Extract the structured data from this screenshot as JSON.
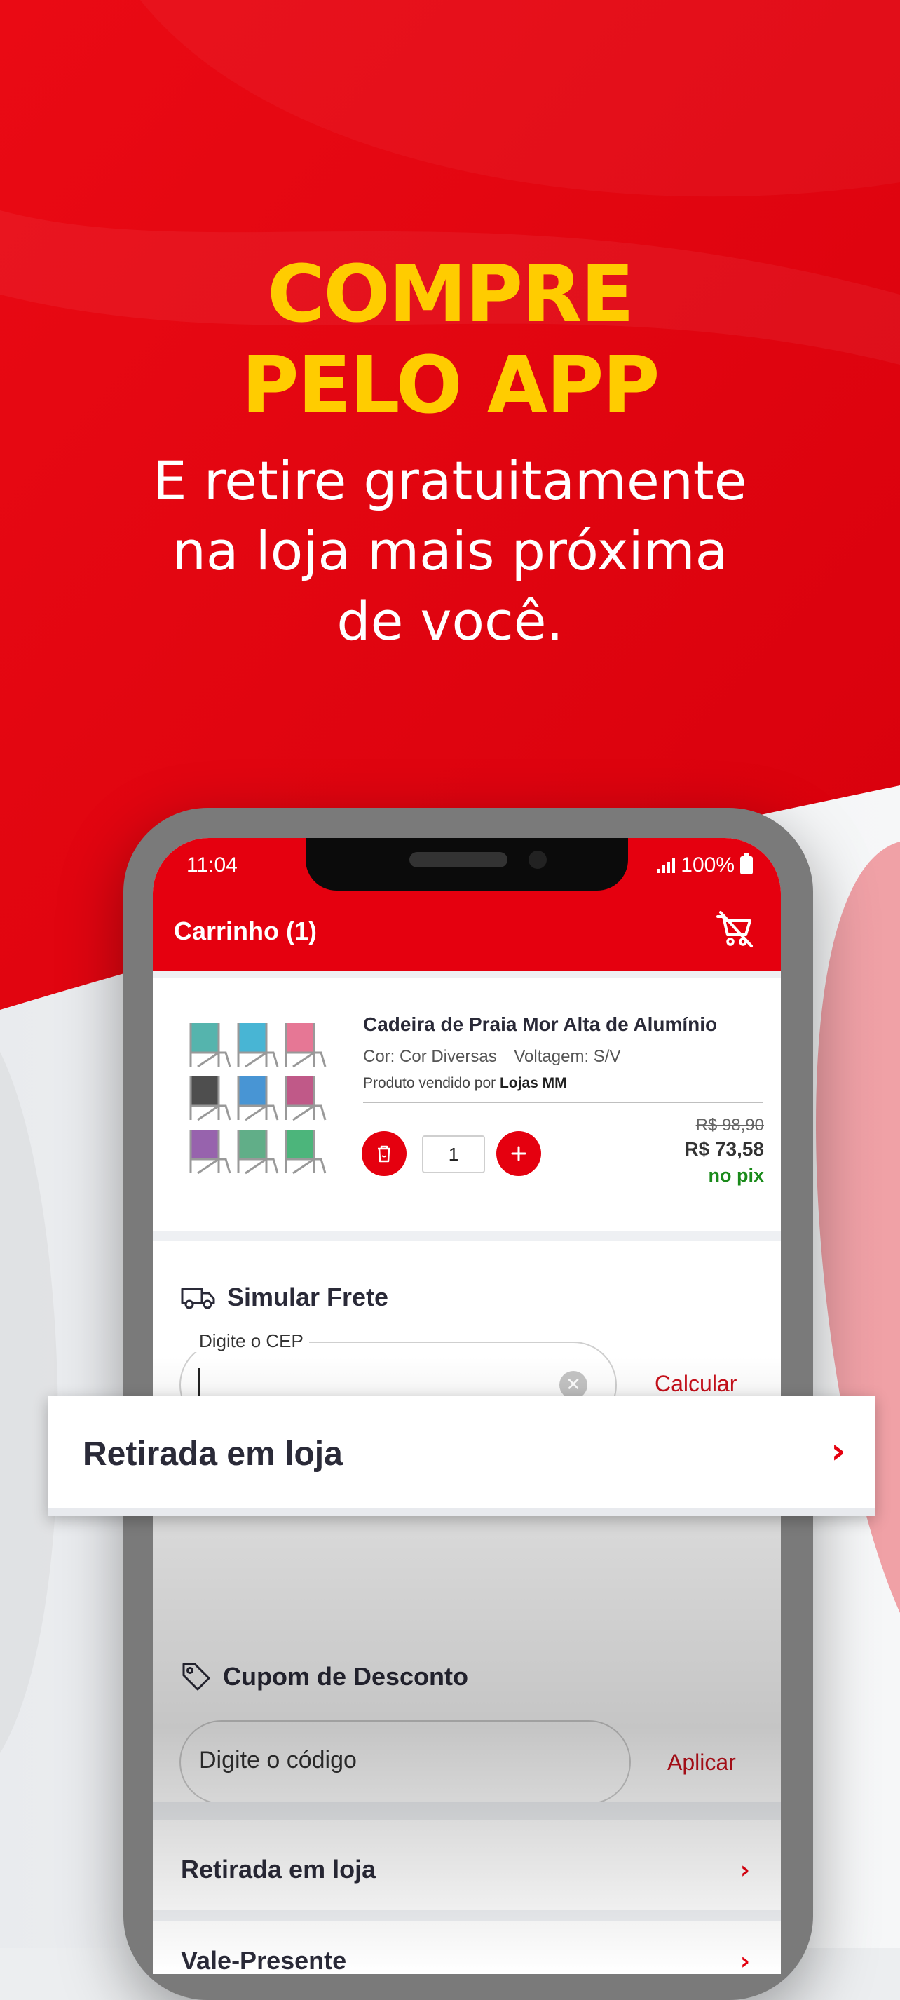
{
  "promo": {
    "headline_line1": "COMPRE",
    "headline_line2": "PELO APP",
    "sub_line1": "E retire gratuitamente",
    "sub_line2": "na loja mais próxima",
    "sub_line3": "de você."
  },
  "status_bar": {
    "time": "11:04",
    "battery": "100%"
  },
  "header": {
    "title": "Carrinho (1)",
    "clear_cart_icon": "cart-remove-icon"
  },
  "product": {
    "name": "Cadeira de Praia Mor Alta de Alumínio",
    "color": "Cor: Cor Diversas",
    "voltage": "Voltagem: S/V",
    "seller_prefix": "Produto vendido por",
    "seller": "Lojas MM",
    "quantity": "1",
    "old_price": "R$ 98,90",
    "new_price": "R$ 73,58",
    "pix_label": "no pix"
  },
  "shipping": {
    "title": "Simular Frete",
    "cep_label": "Digite o CEP",
    "calculate": "Calcular"
  },
  "coupon": {
    "title": "Cupom de Desconto",
    "placeholder": "Digite o código",
    "apply": "Aplicar"
  },
  "rows": {
    "pickup": "Retirada em loja",
    "gift_card": "Vale-Presente"
  },
  "banner": {
    "label": "Retirada em loja"
  },
  "colors": {
    "brand_red": "#e5000f",
    "headline_yellow": "#ffcc00",
    "pix_green": "#1a8a1a"
  }
}
